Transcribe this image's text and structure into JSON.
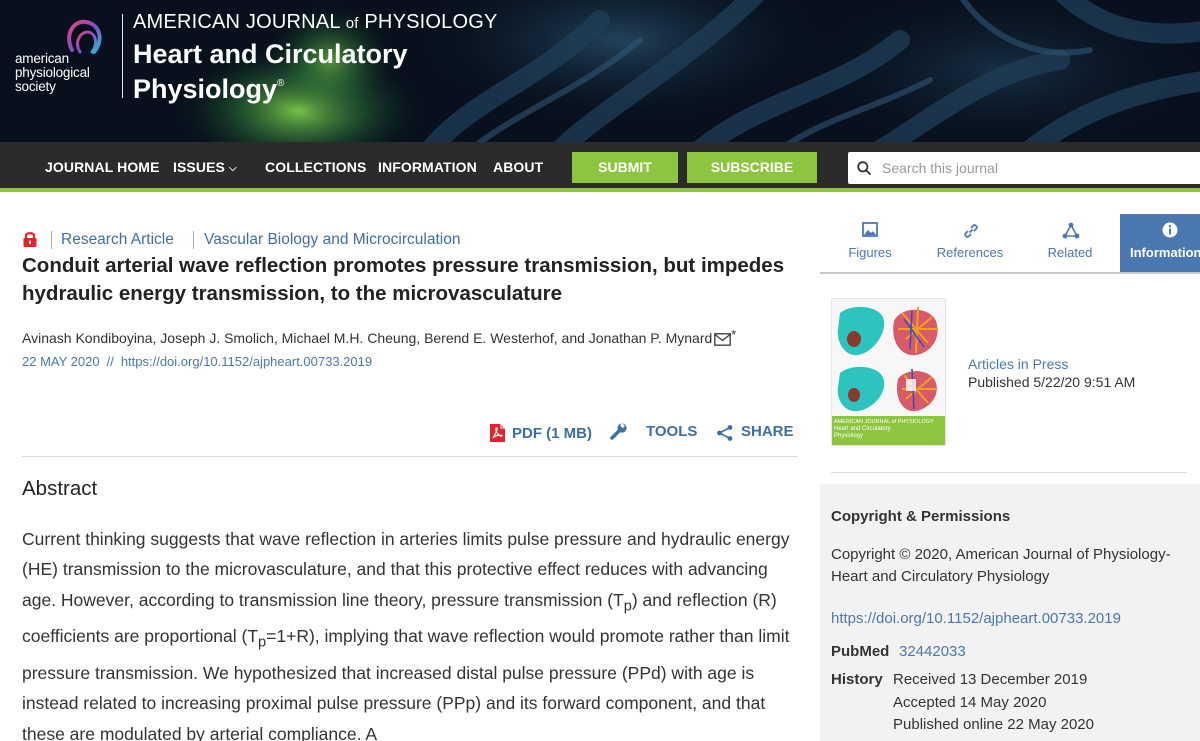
{
  "header": {
    "society_lines": [
      "american",
      "physiological",
      "society"
    ],
    "journal_super_prefix": "AMERICAN JOURNAL",
    "journal_super_of": "of",
    "journal_super_suffix": "PHYSIOLOGY",
    "journal_title_line1": "Heart and Circulatory",
    "journal_title_line2": "Physiology",
    "registered_mark": "®"
  },
  "nav": {
    "items": [
      {
        "label": "JOURNAL HOME"
      },
      {
        "label": "ISSUES"
      },
      {
        "label": "COLLECTIONS"
      },
      {
        "label": "INFORMATION"
      },
      {
        "label": "ABOUT"
      }
    ],
    "issues_caret": "⌵",
    "submit_label": "SUBMIT",
    "subscribe_label": "SUBSCRIBE",
    "search_placeholder": "Search this journal",
    "accent_color": "#8cc63f"
  },
  "article": {
    "access_icon": "lock-icon",
    "type": "Research Article",
    "section": "Vascular Biology and Microcirculation",
    "title": "Conduit arterial wave reflection promotes pressure transmission, but impedes hydraulic energy transmission, to the microvasculature",
    "authors": "Avinash Kondiboyina, Joseph J. Smolich, Michael M.H. Cheung, Berend E. Westerhof, and Jonathan P. Mynard",
    "corresponding_mark": "*",
    "date": "22 MAY 2020",
    "date_separator": "//",
    "doi": "https://doi.org/10.1152/ajpheart.00733.2019",
    "tools": {
      "pdf_label": "PDF (1 MB)",
      "tools_label": "TOOLS",
      "share_label": "SHARE"
    },
    "abstract_heading": "Abstract",
    "abstract": {
      "p1": "Current thinking suggests that wave reflection in arteries limits pulse pressure and hydraulic energy (HE) transmission to the microvasculature, and that this protective effect reduces with advancing age. However, according to transmission line theory, pressure transmission (T",
      "sub1": "p",
      "p2": ") and reflection (R) coefficients are proportional (T",
      "sub2": "p",
      "p3": "=1+R), implying that wave reflection would promote rather than limit pressure transmission. We hypothesized that increased distal pulse pressure (PPd) with age is instead related to increasing proximal pulse pressure (PPp) and its forward component, and that these are modulated by arterial compliance. A"
    }
  },
  "sidebar": {
    "tabs": [
      {
        "label": "Figures",
        "icon": "image-icon"
      },
      {
        "label": "References",
        "icon": "link-icon"
      },
      {
        "label": "Related",
        "icon": "network-icon"
      },
      {
        "label": "Information",
        "icon": "info-icon"
      }
    ],
    "active_tab": "Information",
    "cover_band_line1": "AMERICAN JOURNAL of PHYSIOLOGY",
    "cover_band_line2": "Heart and Circulatory",
    "cover_band_line3": "Physiology",
    "articles_in_press": "Articles in Press",
    "published": "Published 5/22/20 9:51 AM",
    "copyright_heading": "Copyright & Permissions",
    "copyright_text": "Copyright © 2020, American Journal of Physiology-Heart and Circulatory Physiology",
    "doi": "https://doi.org/10.1152/ajpheart.00733.2019",
    "pubmed_label": "PubMed",
    "pubmed_id": "32442033",
    "history_label": "History",
    "history": [
      "Received 13 December 2019",
      "Accepted 14 May 2020",
      "Published online 22 May 2020"
    ]
  }
}
